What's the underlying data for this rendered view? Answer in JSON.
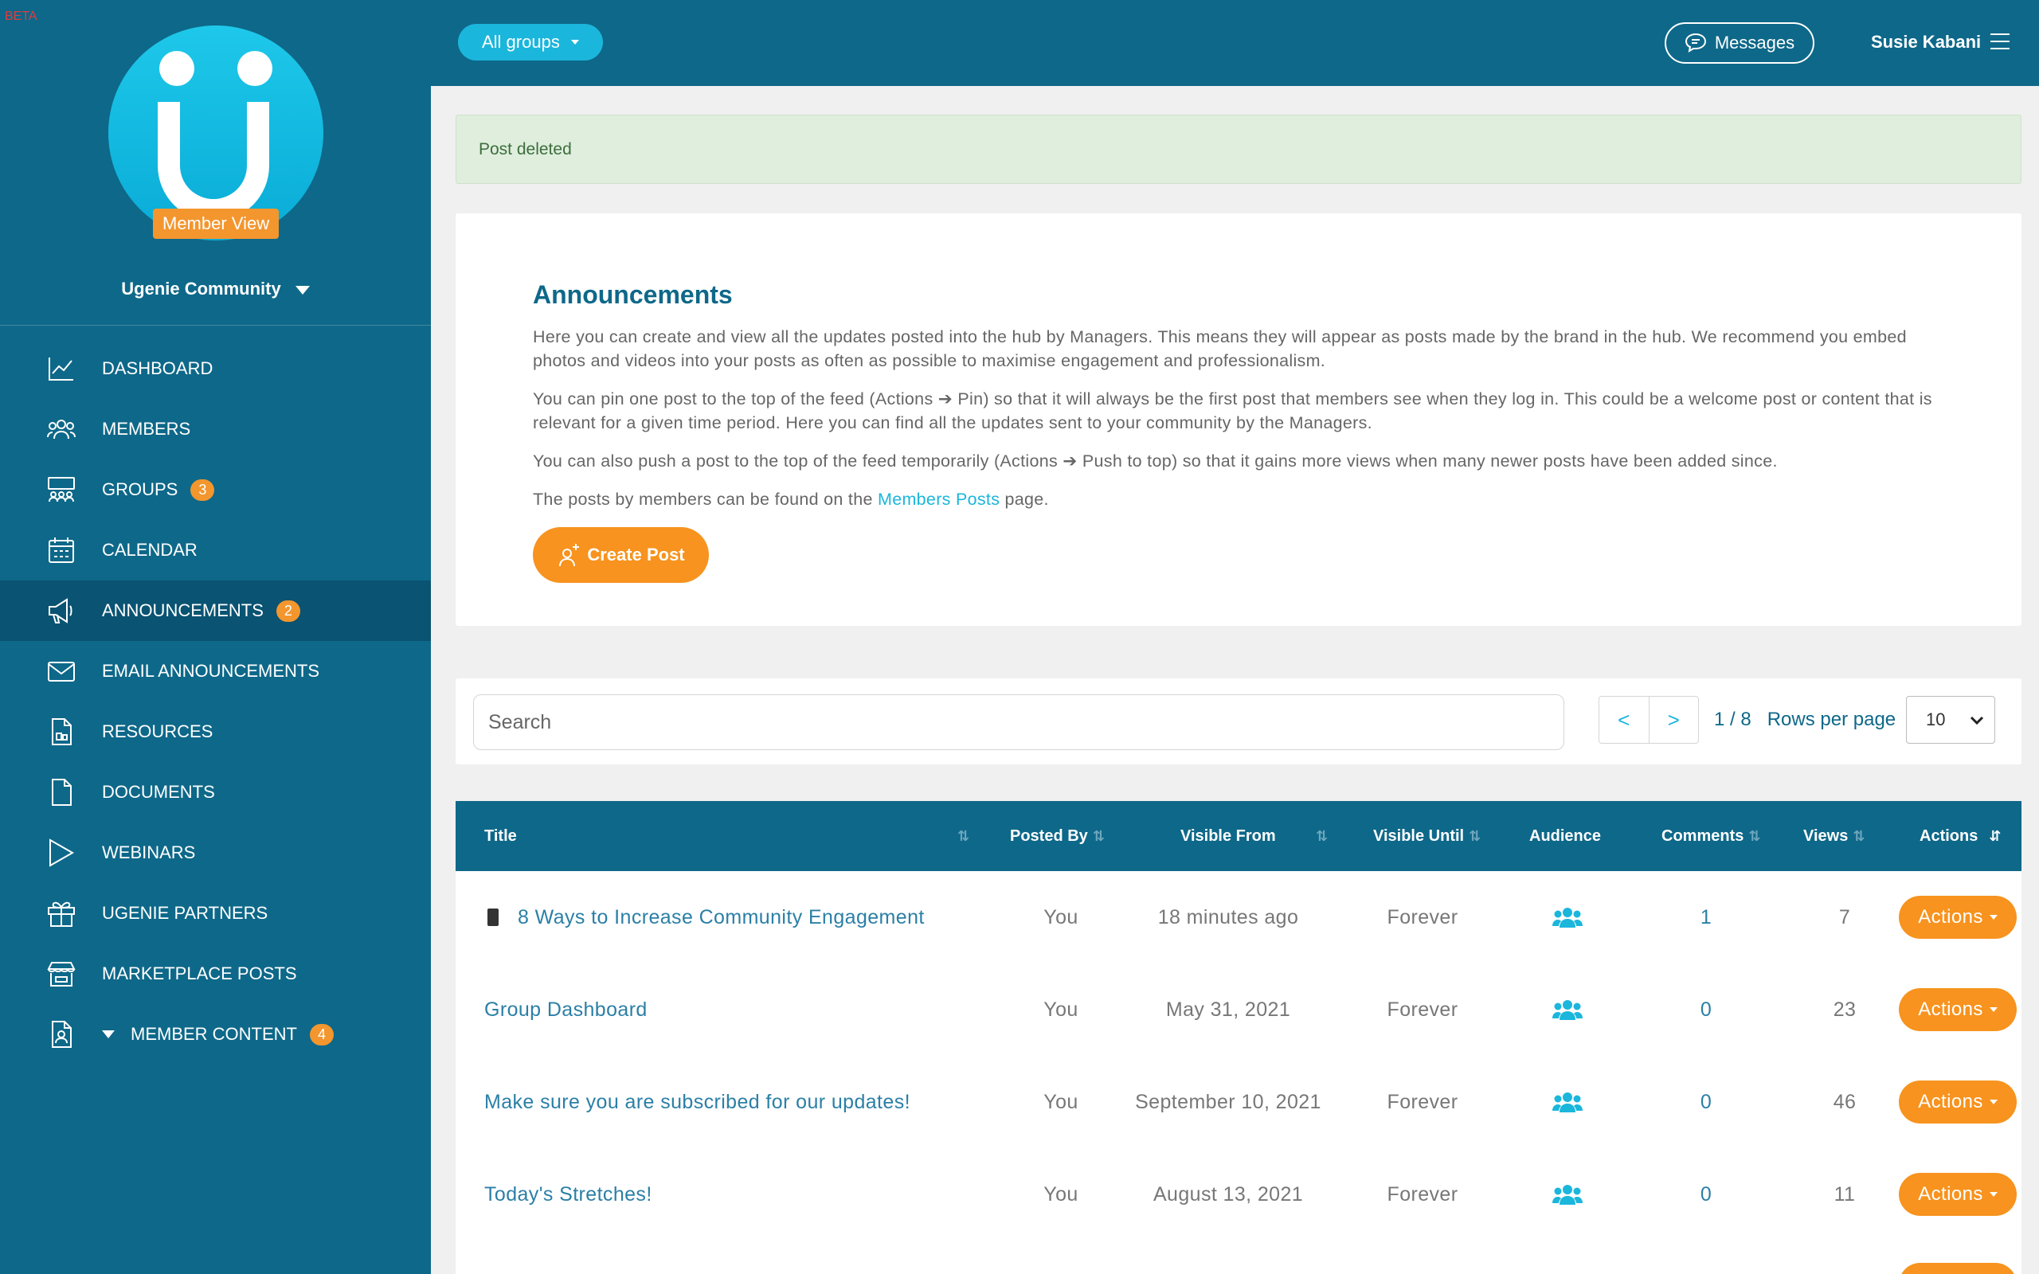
{
  "beta_label": "BETA",
  "sidebar": {
    "member_view": "Member View",
    "community": "Ugenie Community",
    "items": [
      {
        "label": "DASHBOARD",
        "icon": "chart-line-icon",
        "badge": ""
      },
      {
        "label": "MEMBERS",
        "icon": "members-icon",
        "badge": ""
      },
      {
        "label": "GROUPS",
        "icon": "groups-icon",
        "badge": "3"
      },
      {
        "label": "CALENDAR",
        "icon": "calendar-icon",
        "badge": ""
      },
      {
        "label": "ANNOUNCEMENTS",
        "icon": "megaphone-icon",
        "badge": "2",
        "active": true
      },
      {
        "label": "EMAIL ANNOUNCEMENTS",
        "icon": "envelope-icon",
        "badge": ""
      },
      {
        "label": "RESOURCES",
        "icon": "resource-file-icon",
        "badge": ""
      },
      {
        "label": "DOCUMENTS",
        "icon": "document-icon",
        "badge": ""
      },
      {
        "label": "WEBINARS",
        "icon": "play-icon",
        "badge": ""
      },
      {
        "label": "UGENIE PARTNERS",
        "icon": "gift-icon",
        "badge": ""
      },
      {
        "label": "MARKETPLACE POSTS",
        "icon": "store-icon",
        "badge": ""
      },
      {
        "label": "MEMBER CONTENT",
        "icon": "member-content-icon",
        "badge": "4"
      }
    ]
  },
  "topbar": {
    "groups_label": "All groups",
    "messages_label": "Messages",
    "user_name": "Susie Kabani"
  },
  "alert": "Post deleted",
  "announcements": {
    "title": "Announcements",
    "p1": "Here you can create and view all the updates posted into the hub by Managers. This means they will appear as posts made by the brand in the hub. We recommend you embed photos and videos into your posts as often as possible to maximise engagement and professionalism.",
    "p2": "You can pin one post to the top of the feed (Actions ➔ Pin) so that it will always be the first post that members see when they log in. This could be a welcome post or content that is relevant for a given time period. Here you can find all the updates sent to your community by the Managers.",
    "p3": "You can also push a post to the top of the feed temporarily (Actions ➔ Push to top) so that it gains more views when many newer posts have been added since.",
    "p4_before": "The posts by members can be found on the ",
    "p4_link": "Members Posts",
    "p4_after": " page.",
    "create_label": "Create Post"
  },
  "search": {
    "placeholder": "Search",
    "prev": "<",
    "next": ">",
    "page_info": "1 / 8",
    "rows_label": "Rows per page",
    "rows_value": "10"
  },
  "table": {
    "headers": {
      "title": "Title",
      "posted_by": "Posted By",
      "visible_from": "Visible From",
      "visible_until": "Visible Until",
      "audience": "Audience",
      "comments": "Comments",
      "views": "Views",
      "actions": "Actions"
    },
    "rows": [
      {
        "title": "8 Ways to Increase Community Engagement",
        "posted_by": "You",
        "visible_from": "18 minutes ago",
        "visible_until": "Forever",
        "comments": "1",
        "views": "7",
        "action": "Actions",
        "phone": true
      },
      {
        "title": "Group Dashboard",
        "posted_by": "You",
        "visible_from": "May 31, 2021",
        "visible_until": "Forever",
        "comments": "0",
        "views": "23",
        "action": "Actions"
      },
      {
        "title": "Make sure you are subscribed for our updates!",
        "posted_by": "You",
        "visible_from": "September 10, 2021",
        "visible_until": "Forever",
        "comments": "0",
        "views": "46",
        "action": "Actions"
      },
      {
        "title": "Today's Stretches!",
        "posted_by": "You",
        "visible_from": "August 13, 2021",
        "visible_until": "Forever",
        "comments": "0",
        "views": "11",
        "action": "Actions"
      }
    ]
  }
}
